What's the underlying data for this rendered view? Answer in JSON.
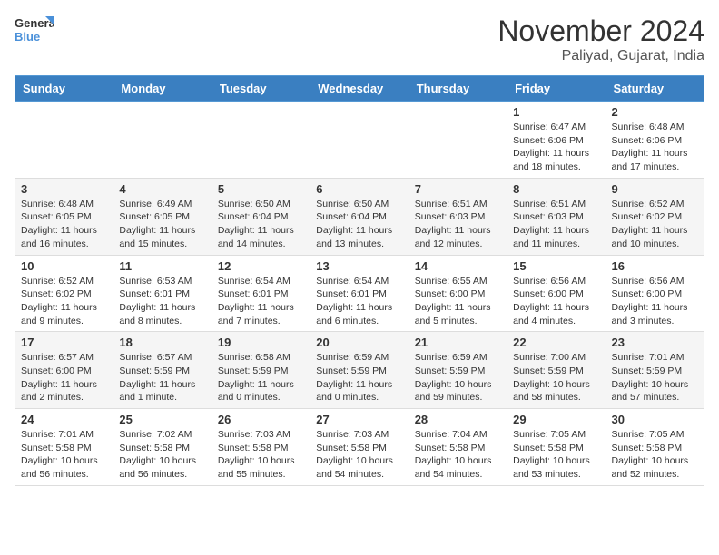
{
  "header": {
    "logo_line1": "General",
    "logo_line2": "Blue",
    "month": "November 2024",
    "location": "Paliyad, Gujarat, India"
  },
  "weekdays": [
    "Sunday",
    "Monday",
    "Tuesday",
    "Wednesday",
    "Thursday",
    "Friday",
    "Saturday"
  ],
  "weeks": [
    [
      {
        "day": "",
        "info": ""
      },
      {
        "day": "",
        "info": ""
      },
      {
        "day": "",
        "info": ""
      },
      {
        "day": "",
        "info": ""
      },
      {
        "day": "",
        "info": ""
      },
      {
        "day": "1",
        "info": "Sunrise: 6:47 AM\nSunset: 6:06 PM\nDaylight: 11 hours and 18 minutes."
      },
      {
        "day": "2",
        "info": "Sunrise: 6:48 AM\nSunset: 6:06 PM\nDaylight: 11 hours and 17 minutes."
      }
    ],
    [
      {
        "day": "3",
        "info": "Sunrise: 6:48 AM\nSunset: 6:05 PM\nDaylight: 11 hours and 16 minutes."
      },
      {
        "day": "4",
        "info": "Sunrise: 6:49 AM\nSunset: 6:05 PM\nDaylight: 11 hours and 15 minutes."
      },
      {
        "day": "5",
        "info": "Sunrise: 6:50 AM\nSunset: 6:04 PM\nDaylight: 11 hours and 14 minutes."
      },
      {
        "day": "6",
        "info": "Sunrise: 6:50 AM\nSunset: 6:04 PM\nDaylight: 11 hours and 13 minutes."
      },
      {
        "day": "7",
        "info": "Sunrise: 6:51 AM\nSunset: 6:03 PM\nDaylight: 11 hours and 12 minutes."
      },
      {
        "day": "8",
        "info": "Sunrise: 6:51 AM\nSunset: 6:03 PM\nDaylight: 11 hours and 11 minutes."
      },
      {
        "day": "9",
        "info": "Sunrise: 6:52 AM\nSunset: 6:02 PM\nDaylight: 11 hours and 10 minutes."
      }
    ],
    [
      {
        "day": "10",
        "info": "Sunrise: 6:52 AM\nSunset: 6:02 PM\nDaylight: 11 hours and 9 minutes."
      },
      {
        "day": "11",
        "info": "Sunrise: 6:53 AM\nSunset: 6:01 PM\nDaylight: 11 hours and 8 minutes."
      },
      {
        "day": "12",
        "info": "Sunrise: 6:54 AM\nSunset: 6:01 PM\nDaylight: 11 hours and 7 minutes."
      },
      {
        "day": "13",
        "info": "Sunrise: 6:54 AM\nSunset: 6:01 PM\nDaylight: 11 hours and 6 minutes."
      },
      {
        "day": "14",
        "info": "Sunrise: 6:55 AM\nSunset: 6:00 PM\nDaylight: 11 hours and 5 minutes."
      },
      {
        "day": "15",
        "info": "Sunrise: 6:56 AM\nSunset: 6:00 PM\nDaylight: 11 hours and 4 minutes."
      },
      {
        "day": "16",
        "info": "Sunrise: 6:56 AM\nSunset: 6:00 PM\nDaylight: 11 hours and 3 minutes."
      }
    ],
    [
      {
        "day": "17",
        "info": "Sunrise: 6:57 AM\nSunset: 6:00 PM\nDaylight: 11 hours and 2 minutes."
      },
      {
        "day": "18",
        "info": "Sunrise: 6:57 AM\nSunset: 5:59 PM\nDaylight: 11 hours and 1 minute."
      },
      {
        "day": "19",
        "info": "Sunrise: 6:58 AM\nSunset: 5:59 PM\nDaylight: 11 hours and 0 minutes."
      },
      {
        "day": "20",
        "info": "Sunrise: 6:59 AM\nSunset: 5:59 PM\nDaylight: 11 hours and 0 minutes."
      },
      {
        "day": "21",
        "info": "Sunrise: 6:59 AM\nSunset: 5:59 PM\nDaylight: 10 hours and 59 minutes."
      },
      {
        "day": "22",
        "info": "Sunrise: 7:00 AM\nSunset: 5:59 PM\nDaylight: 10 hours and 58 minutes."
      },
      {
        "day": "23",
        "info": "Sunrise: 7:01 AM\nSunset: 5:59 PM\nDaylight: 10 hours and 57 minutes."
      }
    ],
    [
      {
        "day": "24",
        "info": "Sunrise: 7:01 AM\nSunset: 5:58 PM\nDaylight: 10 hours and 56 minutes."
      },
      {
        "day": "25",
        "info": "Sunrise: 7:02 AM\nSunset: 5:58 PM\nDaylight: 10 hours and 56 minutes."
      },
      {
        "day": "26",
        "info": "Sunrise: 7:03 AM\nSunset: 5:58 PM\nDaylight: 10 hours and 55 minutes."
      },
      {
        "day": "27",
        "info": "Sunrise: 7:03 AM\nSunset: 5:58 PM\nDaylight: 10 hours and 54 minutes."
      },
      {
        "day": "28",
        "info": "Sunrise: 7:04 AM\nSunset: 5:58 PM\nDaylight: 10 hours and 54 minutes."
      },
      {
        "day": "29",
        "info": "Sunrise: 7:05 AM\nSunset: 5:58 PM\nDaylight: 10 hours and 53 minutes."
      },
      {
        "day": "30",
        "info": "Sunrise: 7:05 AM\nSunset: 5:58 PM\nDaylight: 10 hours and 52 minutes."
      }
    ]
  ]
}
